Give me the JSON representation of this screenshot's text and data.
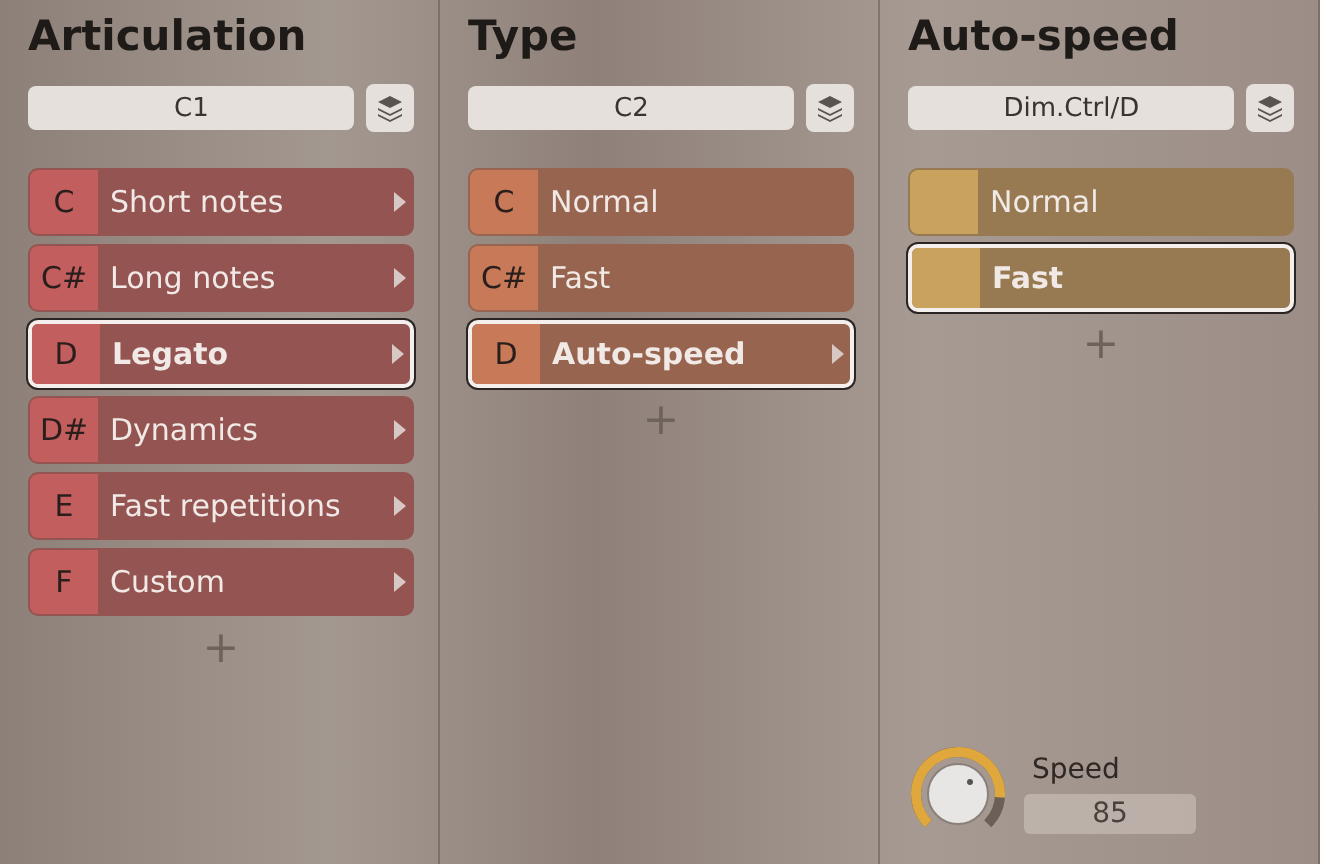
{
  "columns": [
    {
      "title": "Articulation",
      "field": "C1",
      "color": "#c25e5e",
      "items": [
        {
          "key": "C",
          "label": "Short notes",
          "selected": false,
          "has_submenu": true
        },
        {
          "key": "C#",
          "label": "Long notes",
          "selected": false,
          "has_submenu": true
        },
        {
          "key": "D",
          "label": "Legato",
          "selected": true,
          "has_submenu": true
        },
        {
          "key": "D#",
          "label": "Dynamics",
          "selected": false,
          "has_submenu": true
        },
        {
          "key": "E",
          "label": "Fast repetitions",
          "selected": false,
          "has_submenu": true
        },
        {
          "key": "F",
          "label": "Custom",
          "selected": false,
          "has_submenu": true
        }
      ],
      "add": "+"
    },
    {
      "title": "Type",
      "field": "C2",
      "color": "#c87a58",
      "items": [
        {
          "key": "C",
          "label": "Normal",
          "selected": false,
          "has_submenu": false
        },
        {
          "key": "C#",
          "label": "Fast",
          "selected": false,
          "has_submenu": false
        },
        {
          "key": "D",
          "label": "Auto-speed",
          "selected": true,
          "has_submenu": true
        }
      ],
      "add": "+"
    },
    {
      "title": "Auto-speed",
      "field": "Dim.Ctrl/D",
      "color": "#c9a35e",
      "items": [
        {
          "label": "Normal",
          "selected": false,
          "has_submenu": false
        },
        {
          "label": "Fast",
          "selected": true,
          "has_submenu": false
        }
      ],
      "add": "+",
      "knob": {
        "label": "Speed",
        "value": "85"
      }
    }
  ]
}
